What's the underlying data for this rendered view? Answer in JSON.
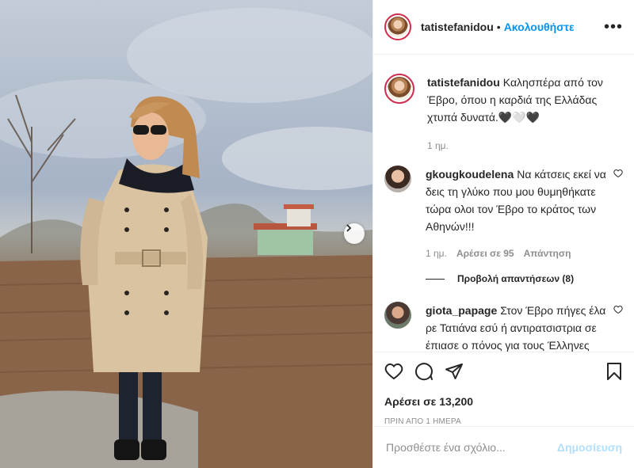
{
  "post": {
    "username": "tatistefanidou",
    "follow_label": "Ακολουθήστε",
    "separator": "•",
    "more_label": "•••"
  },
  "caption": {
    "username": "tatistefanidou",
    "text": "Καλησπέρα από τον Έβρο, όπου η καρδιά της Ελλάδας χτυπά δυνατά.🖤🤍🖤",
    "time": "1 ημ."
  },
  "comments": [
    {
      "username": "gkougkoudelena",
      "text": "Να κάτσεις εκεί να δεις τη γλύκο που μου θυμηθήκατε τώρα ολοι τον Έβρο το κράτος των Αθηνών!!!",
      "time": "1 ημ.",
      "likes": "Αρέσει σε 95",
      "reply": "Απάντηση",
      "view_replies": "Προβολή απαντήσεων (8)"
    },
    {
      "username": "giota_papage",
      "text": "Στον Έβρο πήγες έλα ρε Τατιάνα εσύ ή αντιρατσιστρια σε έπιασε ο πόνος για τους Έλληνες ένας δεν βρέθηκε να σε στείλει στον"
    }
  ],
  "actions": {
    "like_icon": "heart-icon",
    "comment_icon": "comment-icon",
    "share_icon": "paper-plane-icon",
    "save_icon": "bookmark-icon"
  },
  "likes_count": "Αρέσει σε 13,200",
  "posted_ago": "ΠΡΙΝ ΑΠΟ 1 ΗΜΕΡΑ",
  "add_comment": {
    "placeholder": "Προσθέστε ένα σχόλιο...",
    "post_label": "Δημοσίευση"
  },
  "colors": {
    "accent": "#0095f6",
    "post_disabled": "#b2dffc",
    "story_ring": "#d12a4a"
  }
}
